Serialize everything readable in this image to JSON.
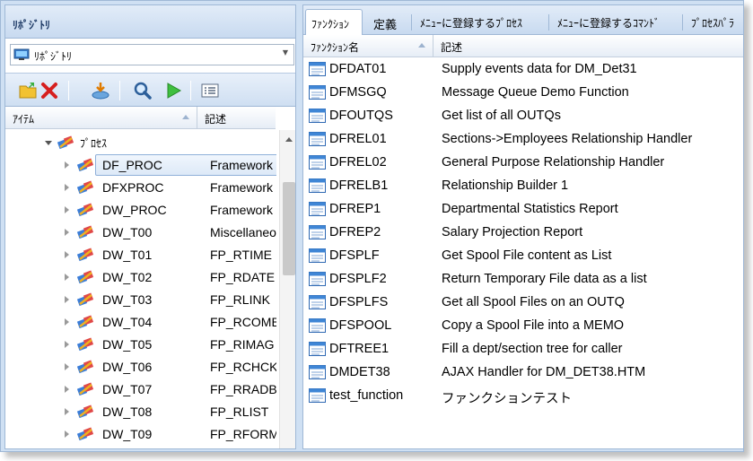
{
  "left_panel": {
    "title": "ﾘﾎﾟｼﾞﾄﾘ",
    "combo_value": "ﾘﾎﾟｼﾞﾄﾘ",
    "toolbar": [
      "open-folder-icon",
      "delete-icon",
      "import-icon",
      "search-icon",
      "run-icon",
      "list-view-icon"
    ],
    "columns": {
      "item": "ｱｲﾃﾑ",
      "desc": "記述"
    },
    "tree": {
      "root": "ﾌﾟﾛｾｽ",
      "items": [
        {
          "name": "DF_PROC",
          "desc": "Framework",
          "selected": true
        },
        {
          "name": "DFXPROC",
          "desc": "Framework"
        },
        {
          "name": "DW_PROC",
          "desc": "Framework"
        },
        {
          "name": "DW_T00",
          "desc": "Miscellaneo"
        },
        {
          "name": "DW_T01",
          "desc": "FP_RTIME"
        },
        {
          "name": "DW_T02",
          "desc": "FP_RDATE"
        },
        {
          "name": "DW_T03",
          "desc": "FP_RLINK"
        },
        {
          "name": "DW_T04",
          "desc": "FP_RCOMB"
        },
        {
          "name": "DW_T05",
          "desc": "FP_RIMAG"
        },
        {
          "name": "DW_T06",
          "desc": "FP_RCHCK"
        },
        {
          "name": "DW_T07",
          "desc": "FP_RRADB"
        },
        {
          "name": "DW_T08",
          "desc": "FP_RLIST"
        },
        {
          "name": "DW_T09",
          "desc": "FP_RFORM"
        }
      ]
    }
  },
  "right_panel": {
    "tabs": [
      "ﾌｧﾝｸｼｮﾝ",
      "定義",
      "ﾒﾆｭｰに登録するﾌﾟﾛｾｽ",
      "ﾒﾆｭｰに登録するｺﾏﾝﾄﾞ",
      "ﾌﾟﾛｾｽﾊﾟﾗ"
    ],
    "active_tab": 0,
    "columns": {
      "name": "ﾌｧﾝｸｼｮﾝ名",
      "desc": "記述"
    },
    "functions": [
      {
        "name": "DFDAT01",
        "desc": "Supply events data for DM_Det31"
      },
      {
        "name": "DFMSGQ",
        "desc": "Message Queue Demo Function"
      },
      {
        "name": "DFOUTQS",
        "desc": "Get list of all OUTQs"
      },
      {
        "name": "DFREL01",
        "desc": "Sections->Employees Relationship Handler"
      },
      {
        "name": "DFREL02",
        "desc": "General Purpose Relationship Handler"
      },
      {
        "name": "DFRELB1",
        "desc": "Relationship Builder 1"
      },
      {
        "name": "DFREP1",
        "desc": "Departmental Statistics Report"
      },
      {
        "name": "DFREP2",
        "desc": "Salary Projection Report"
      },
      {
        "name": "DFSPLF",
        "desc": "Get Spool File content as List"
      },
      {
        "name": "DFSPLF2",
        "desc": "Return Temporary File data as a list"
      },
      {
        "name": "DFSPLFS",
        "desc": "Get all Spool Files on an OUTQ"
      },
      {
        "name": "DFSPOOL",
        "desc": "Copy a Spool File into a MEMO"
      },
      {
        "name": "DFTREE1",
        "desc": "Fill a dept/section tree for caller"
      },
      {
        "name": "DMDET38",
        "desc": "AJAX Handler for DM_DET38.HTM"
      },
      {
        "name": "test_function",
        "desc": "ファンクションテスト"
      }
    ]
  },
  "colors": {
    "accent": "#cfe0f3",
    "border": "#9fb8d6",
    "selection": "#dde9f7"
  }
}
